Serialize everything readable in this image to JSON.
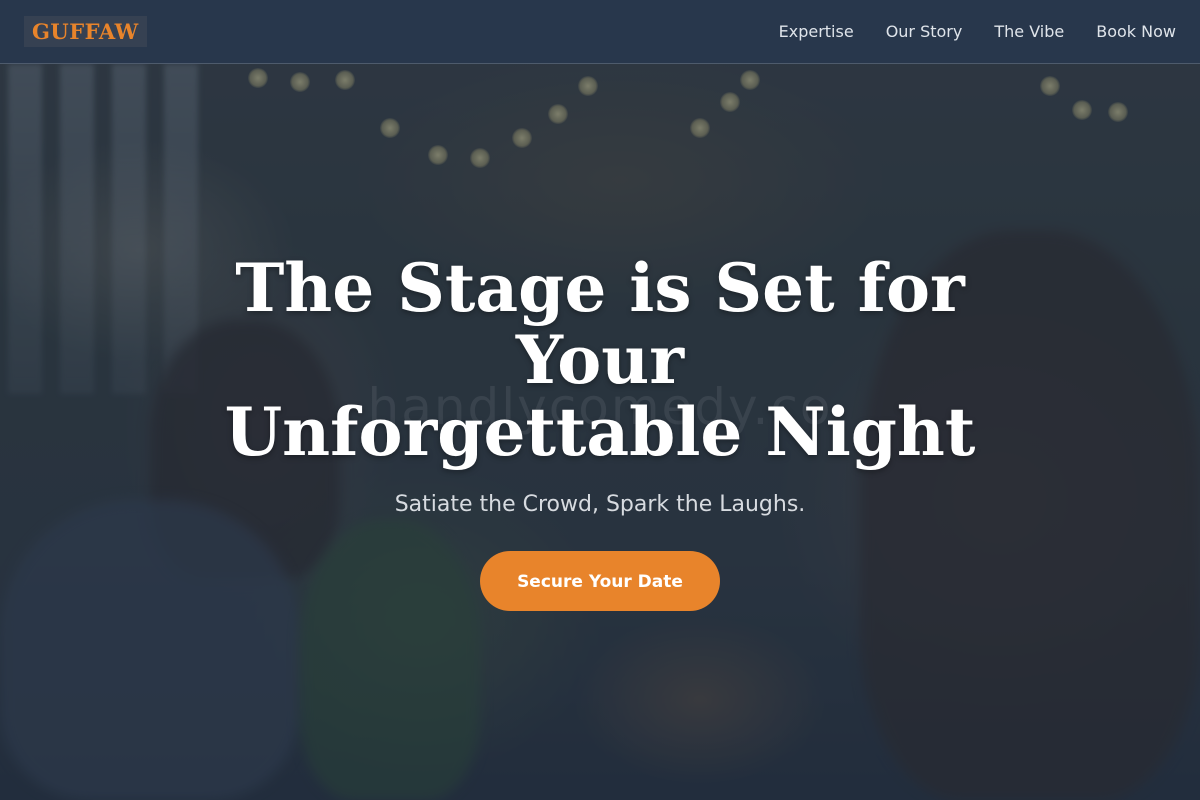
{
  "header": {
    "logo": "GUFFAW",
    "nav": [
      {
        "label": "Expertise"
      },
      {
        "label": "Our Story"
      },
      {
        "label": "The Vibe"
      },
      {
        "label": "Book Now"
      }
    ]
  },
  "hero": {
    "title_line1": "The Stage is Set for Your",
    "title_line2": "Unforgettable Night",
    "subtitle": "Satiate the Crowd, Spark the Laughs.",
    "cta_label": "Secure Your Date",
    "watermark": "handlycomedy.co"
  },
  "colors": {
    "accent": "#e8842b",
    "header_bg": "#283750",
    "text_light": "#ffffff"
  }
}
